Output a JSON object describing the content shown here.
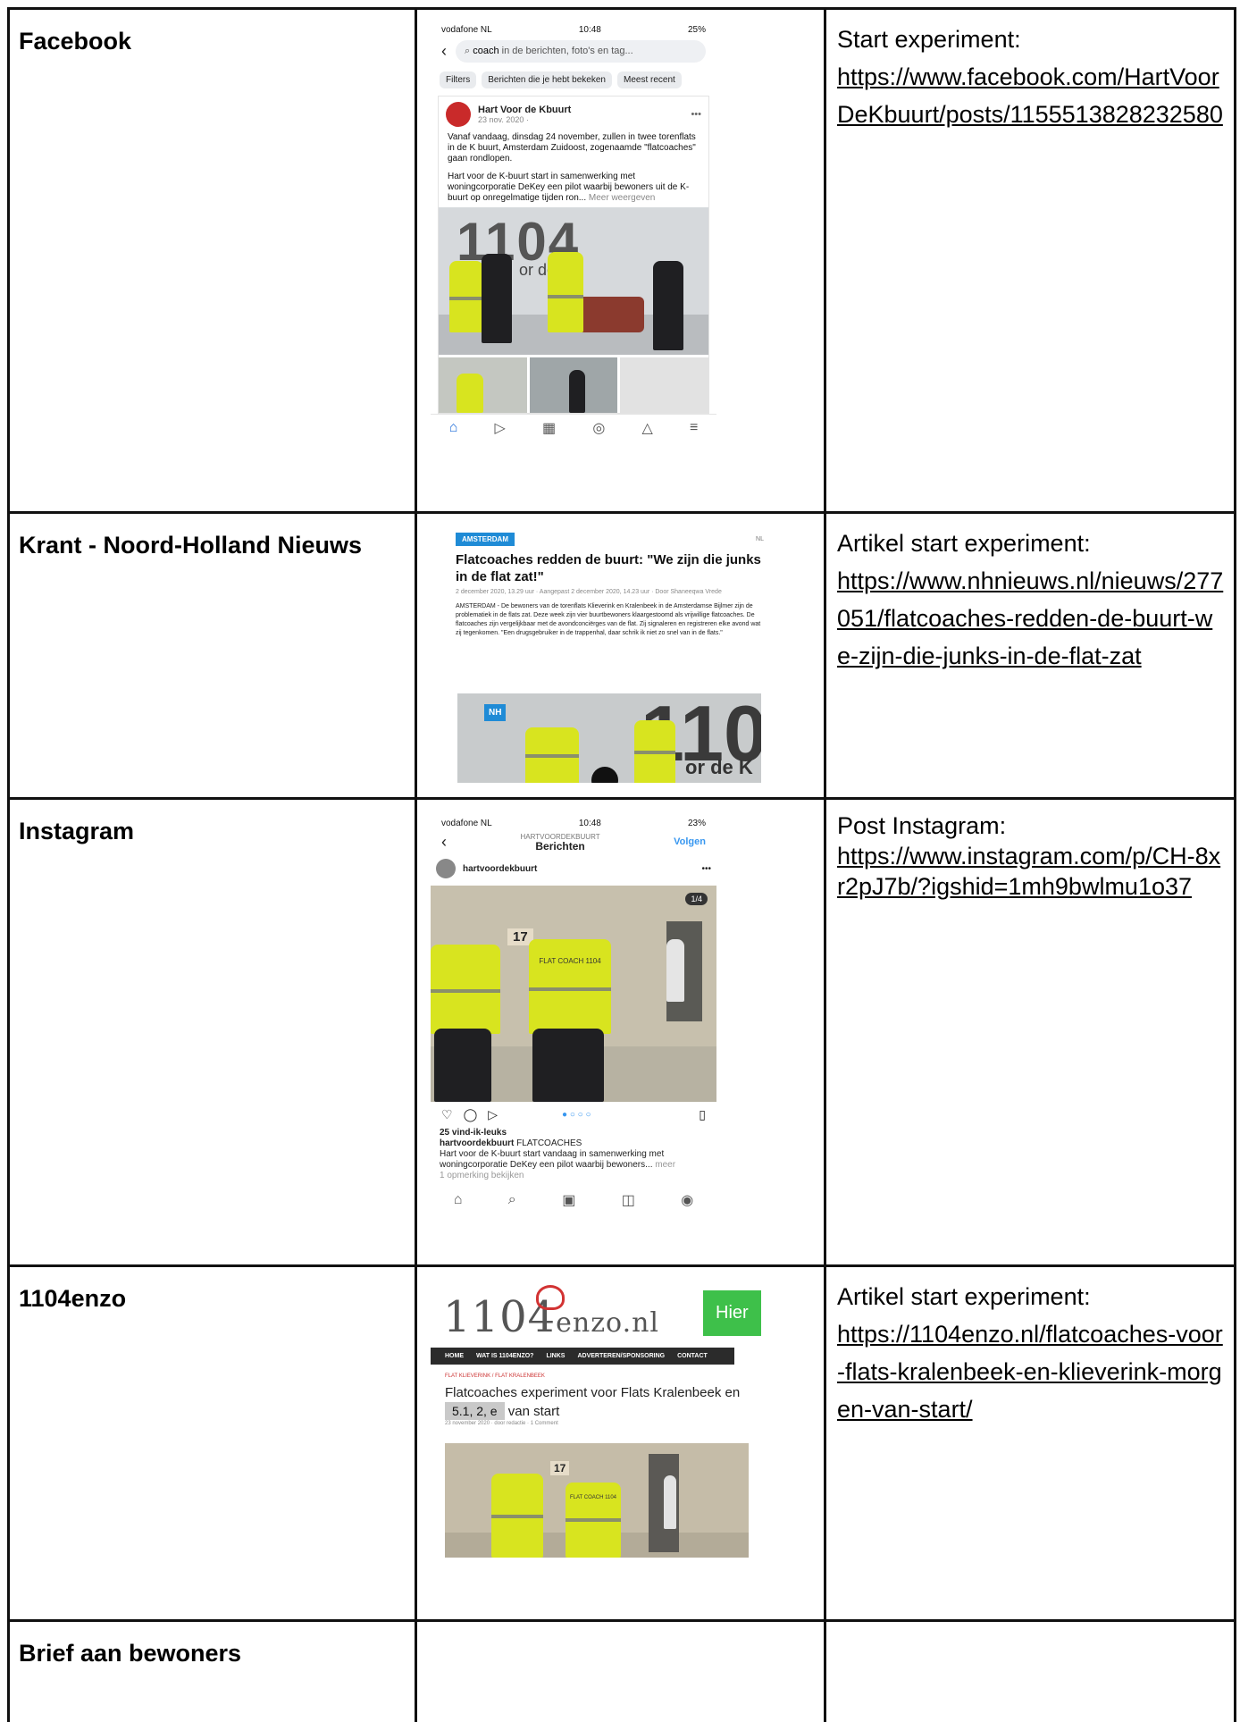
{
  "rows": [
    {
      "platform": "Facebook",
      "desc_label": "Start experiment:",
      "link": "https://www.facebook.com/HartVoorDeKbuurt/posts/1155513828232580"
    },
    {
      "platform": "Krant - Noord-Holland Nieuws",
      "desc_label": "Artikel start experiment:",
      "link": "https://www.nhnieuws.nl/nieuws/277051/flatcoaches-redden-de-buurt-we-zijn-die-junks-in-de-flat-zat"
    },
    {
      "platform": "Instagram",
      "desc_label": "Post Instagram:",
      "link": "https://www.instagram.com/p/CH-8xr2pJ7b/?igshid=1mh9bwlmu1o37"
    },
    {
      "platform": "1104enzo",
      "desc_label": "Artikel start experiment:",
      "link": "https://1104enzo.nl/flatcoaches-voor-flats-kralenbeek-en-klieverink-morgen-van-start/"
    },
    {
      "platform": "Brief aan bewoners",
      "desc_label": "",
      "link": ""
    }
  ],
  "facebook_shot": {
    "carrier": "vodafone NL",
    "time": "10:48",
    "battery": "25%",
    "search_query": "coach",
    "search_rest": " in de berichten, foto's en tag...",
    "chips": [
      "Filters",
      "Berichten die je hebt bekeken",
      "Meest recent"
    ],
    "page_name": "Hart Voor de Kbuurt",
    "post_date": "23 nov. 2020 · ",
    "post_text_1": "Vanaf vandaag, dinsdag 24 november, zullen in twee torenflats in de K buurt, Amsterdam Zuidoost, zogenaamde \"flatcoaches\" gaan rondlopen.",
    "post_text_2": "Hart voor de K-buurt start in samenwerking met woningcorporatie DeKey een pilot waarbij bewoners uit de K-buurt op onregelmatige tijden ron...",
    "more": "Meer weergeven",
    "wall_text": "1104",
    "wall_sub": "or de"
  },
  "nh_shot": {
    "tag": "AMSTERDAM",
    "corner": "NL",
    "title": "Flatcoaches redden de buurt: \"We zijn die junks in de flat zat!\"",
    "meta": "2 december 2020, 13.29 uur · Aangepast 2 december 2020, 14.23 uur · Door Shaneeqwa Vrede",
    "body": "AMSTERDAM - De bewoners van de torenflats Klieverink en Kralenbeek in de Amsterdamse Bijlmer zijn de problematiek in de flats zat. Deze week zijn vier buurtbewoners klaargestoomd als vrijwillige flatcoaches. De flatcoaches zijn vergelijkbaar met de avondconciërges van de flat. Zij signaleren en registreren elke avond wat zij tegenkomen. \"Een drugsgebruiker in de trappenhal, daar schrik ik niet zo snel van in de flats.\"",
    "badge": "NH",
    "wall_text": "110",
    "wall_sub": "or de K"
  },
  "ig_shot": {
    "carrier": "vodafone NL",
    "time": "10:48",
    "battery": "23%",
    "header_top": "HARTVOORDEKBUURT",
    "header_title": "Berichten",
    "follow": "Volgen",
    "username": "hartvoordekbuurt",
    "counter": "1/4",
    "door_number": "17",
    "jacket_text": "FLAT COACH 1104",
    "likes": "25 vind-ik-leuks",
    "caption_user": "hartvoordekbuurt",
    "caption_head": " FLATCOACHES",
    "caption_text": "Hart voor de K-buurt start vandaag in samenwerking met woningcorporatie DeKey een pilot waarbij bewoners...",
    "caption_more": "meer",
    "comments": "1 opmerking bekijken"
  },
  "enzo_shot": {
    "logo_main": "1104",
    "logo_suffix": "enzo.nl",
    "hier": "Hier",
    "nav": [
      "HOME",
      "WAT IS 1104ENZO?",
      "LINKS",
      "ADVERTEREN/SPONSORING",
      "CONTACT"
    ],
    "category": "FLAT KLIEVERINK / FLAT KRALENBEEK",
    "title_line1": "Flatcoaches experiment voor Flats Kralenbeek en",
    "redaction": "5.1, 2, e",
    "title_line2": "van start",
    "meta": "23 november 2020 · door redactie · 1 Comment",
    "door_number": "17",
    "jacket_text": "FLAT COACH 1104"
  }
}
